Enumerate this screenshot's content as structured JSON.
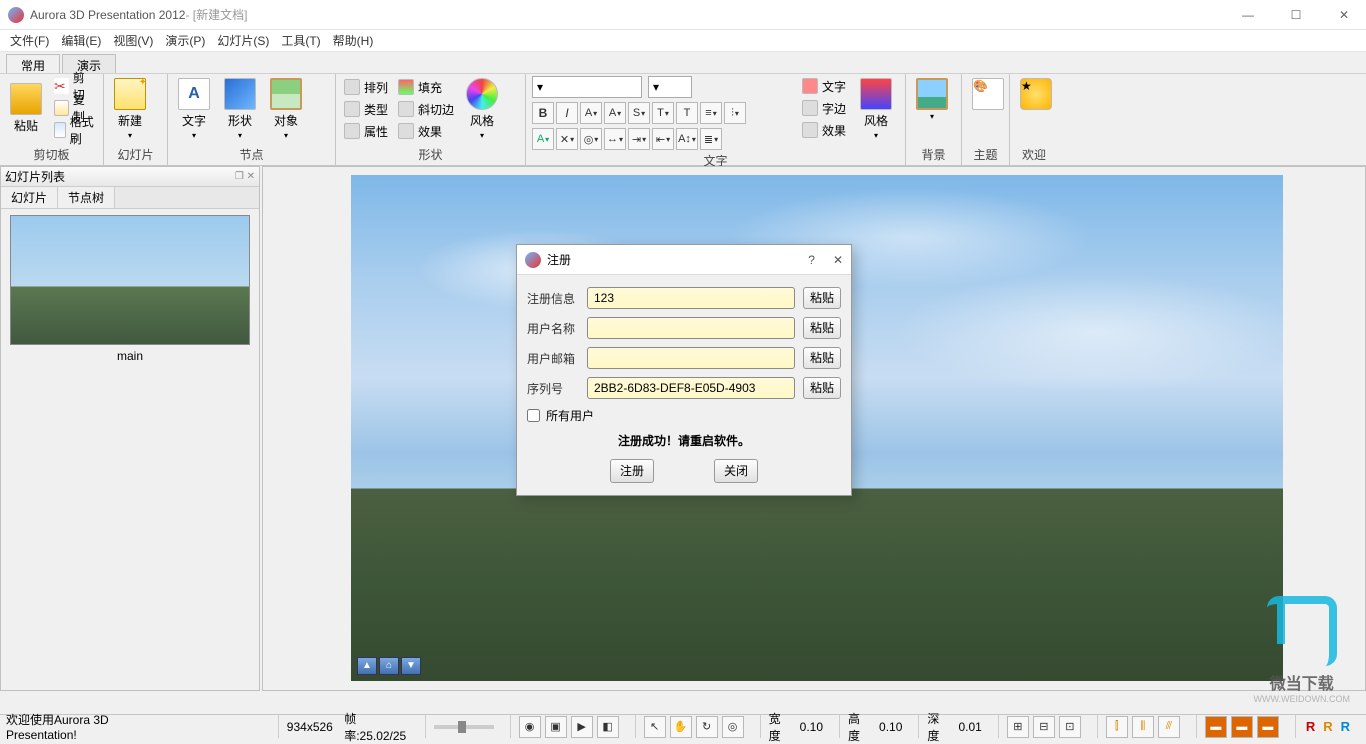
{
  "title": {
    "app": "Aurora 3D Presentation 2012",
    "doc": " - [新建文档]"
  },
  "menu": [
    "文件(F)",
    "编辑(E)",
    "视图(V)",
    "演示(P)",
    "幻灯片(S)",
    "工具(T)",
    "帮助(H)"
  ],
  "rtabs": {
    "common": "常用",
    "present": "演示"
  },
  "ribbon": {
    "clipboard": {
      "paste": "粘贴",
      "cut": "剪切",
      "copy": "复制",
      "brush": "格式刷",
      "group": "剪切板"
    },
    "slide": {
      "new": "新建",
      "group": "幻灯片"
    },
    "node": {
      "text": "文字",
      "shape": "形状",
      "object": "对象",
      "group": "节点"
    },
    "shape": {
      "arrange": "排列",
      "type": "类型",
      "prop": "属性",
      "fill": "填充",
      "bevel": "斜切边",
      "effect": "效果",
      "style": "风格",
      "group": "形状"
    },
    "textgrp": {
      "text": "文字",
      "border": "字边",
      "effect": "效果",
      "style": "风格",
      "group": "文字"
    },
    "design": {
      "bg": "背景",
      "theme": "主题",
      "welcome": "欢迎"
    }
  },
  "dock": {
    "title": "幻灯片列表",
    "tab1": "幻灯片",
    "tab2": "节点树",
    "thumb": "main"
  },
  "dialog": {
    "title": "注册",
    "info_lbl": "注册信息",
    "info_val": "123",
    "user_lbl": "用户名称",
    "user_val": "",
    "mail_lbl": "用户邮箱",
    "mail_val": "",
    "serial_lbl": "序列号",
    "serial_val": "2BB2-6D83-DEF8-E05D-4903",
    "paste": "粘贴",
    "alluser": "所有用户",
    "msg": "注册成功！请重启软件。",
    "reg": "注册",
    "close": "关闭"
  },
  "status": {
    "welcome": "欢迎使用Aurora 3D Presentation!",
    "dims": "934x526",
    "fps": "帧率:25.02/25",
    "width_lbl": "宽度",
    "width": "0.10",
    "height_lbl": "高度",
    "height": "0.10",
    "depth_lbl": "深度",
    "depth": "0.01"
  },
  "watermark": {
    "txt": "微当下载",
    "sub": "WWW.WEIDOWN.COM"
  }
}
